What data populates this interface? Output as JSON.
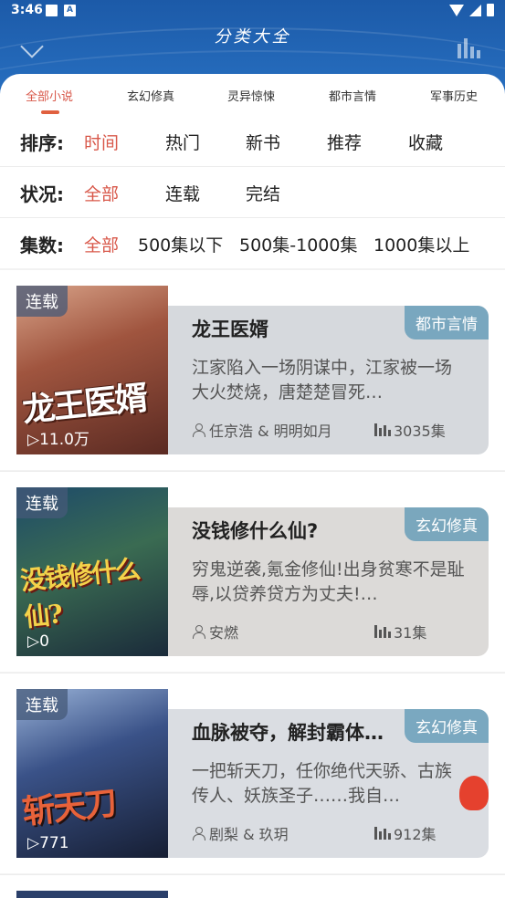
{
  "status": {
    "time": "3:46",
    "icon_a": "A"
  },
  "header": {
    "title": "分类大全"
  },
  "tabs": [
    {
      "label": "全部小说",
      "active": true
    },
    {
      "label": "玄幻修真",
      "active": false
    },
    {
      "label": "灵异惊悚",
      "active": false
    },
    {
      "label": "都市言情",
      "active": false
    },
    {
      "label": "军事历史",
      "active": false
    }
  ],
  "filters": {
    "sort": {
      "label": "排序:",
      "options": [
        "时间",
        "热门",
        "新书",
        "推荐",
        "收藏"
      ],
      "selected": "时间"
    },
    "status": {
      "label": "状况:",
      "options": [
        "全部",
        "连载",
        "完结"
      ],
      "selected": "全部"
    },
    "episodes": {
      "label": "集数:",
      "options": [
        "全部",
        "500集以下",
        "500集-1000集",
        "1000集以上"
      ],
      "selected": "全部"
    }
  },
  "books": [
    {
      "badge": "连载",
      "cover_text": "龙王医婿",
      "plays": "▷11.0万",
      "category": "都市言情",
      "title": "龙王医婿",
      "desc": "江家陷入一场阴谋中，江家被一场大火焚烧，唐楚楚冒死…",
      "authors": "任京浩 & 明明如月",
      "episodes": "3035集",
      "cover_color": "#7a3b2e",
      "cover_color2": "#d9a48a",
      "info_color": "#d6d9dd"
    },
    {
      "badge": "连载",
      "cover_text": "没钱修什么仙?",
      "plays": "▷0",
      "category": "玄幻修真",
      "title": "没钱修什么仙?",
      "desc": "穷鬼逆袭,氪金修仙!出身贫寒不是耻辱,以贷养贷方为丈夫!…",
      "authors": "安燃",
      "episodes": "31集",
      "cover_color": "#1d4a6a",
      "cover_color2": "#d9b23b",
      "info_color": "#dcdad8"
    },
    {
      "badge": "连载",
      "cover_text": "斩天刀",
      "plays": "▷771",
      "category": "玄幻修真",
      "title": "血脉被夺，解封霸体…",
      "desc": "一把斩天刀，任你绝代天骄、古族传人、妖族圣子……我自…",
      "authors": "剧梨 & 玖玥",
      "episodes": "912集",
      "cover_color": "#2a3f6a",
      "cover_color2": "#9ab3d8",
      "info_color": "#dadde2"
    }
  ]
}
